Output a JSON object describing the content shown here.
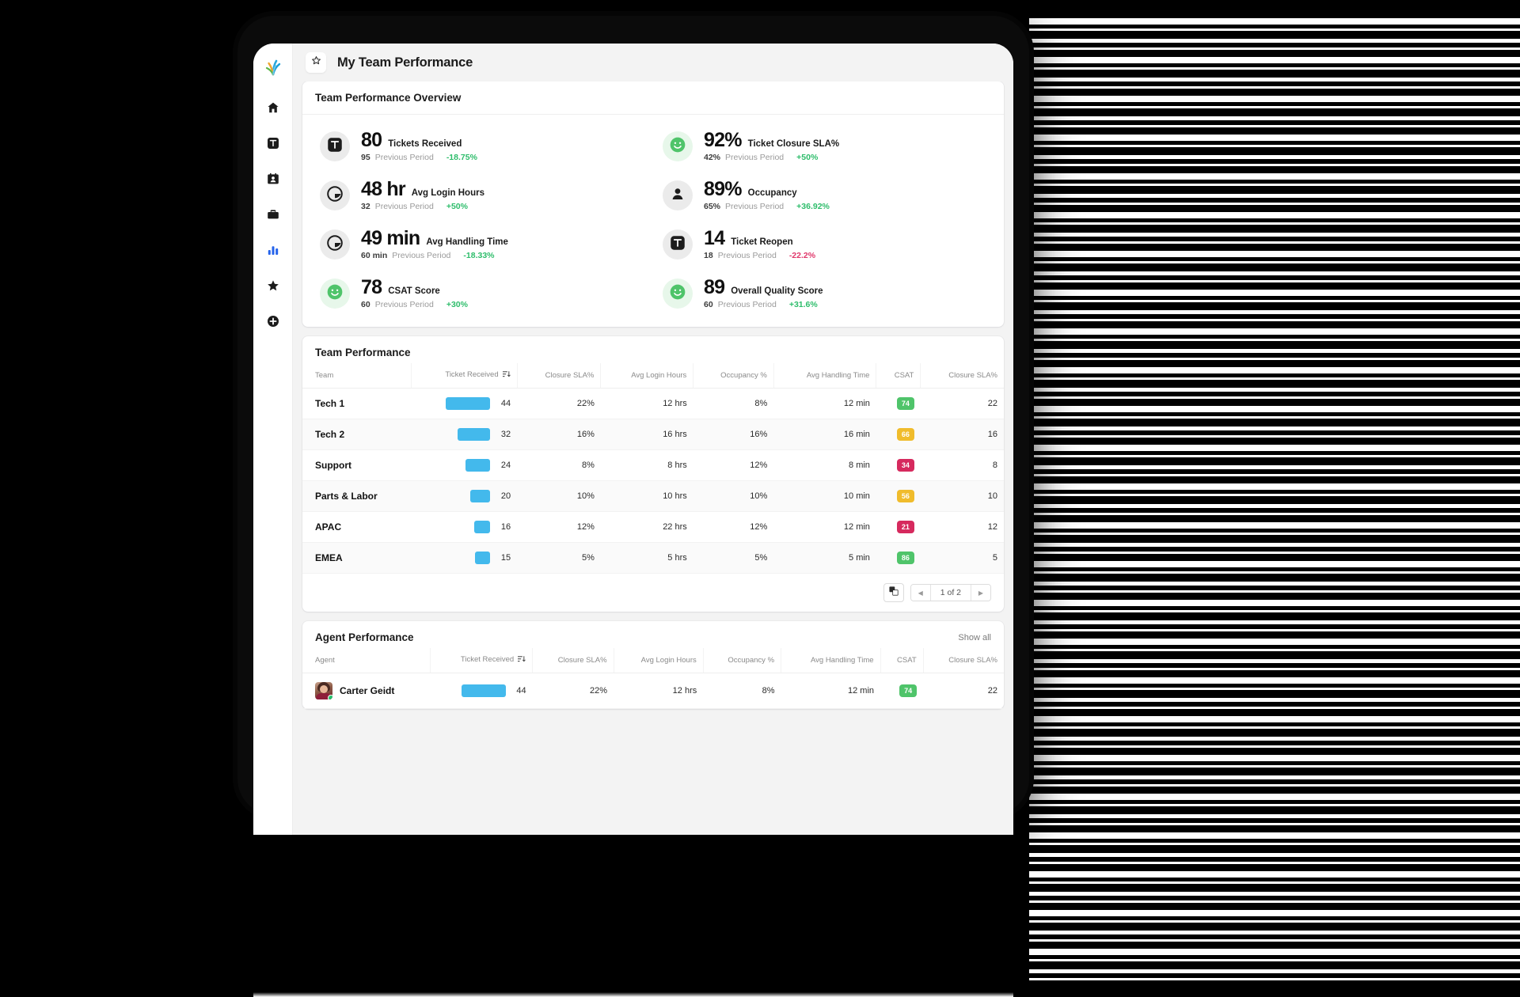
{
  "app": {
    "logo_name": "freshworks-logo",
    "page_title": "My Team Performance",
    "star_icon": "star-outline-icon"
  },
  "sidebar": {
    "items": [
      {
        "name": "home",
        "icon": "home-icon",
        "active": false
      },
      {
        "name": "tickets",
        "icon": "ticket-t-icon",
        "active": false
      },
      {
        "name": "contacts",
        "icon": "contact-card-icon",
        "active": false
      },
      {
        "name": "deals",
        "icon": "briefcase-icon",
        "active": false
      },
      {
        "name": "analytics",
        "icon": "bar-chart-icon",
        "active": true
      },
      {
        "name": "favorites",
        "icon": "star-icon",
        "active": false
      },
      {
        "name": "add",
        "icon": "plus-circle-icon",
        "active": false
      }
    ]
  },
  "overview": {
    "title": "Team Performance Overview",
    "previous_period_label": "Previous Period",
    "kpis": [
      {
        "icon": "ticket-t-icon",
        "icon_style": "dark",
        "value": "80",
        "label": "Tickets Received",
        "prev": "95",
        "delta": "-18.75%",
        "delta_dir": "up"
      },
      {
        "icon": "smiley-icon",
        "icon_style": "green",
        "value": "92%",
        "label": "Ticket Closure SLA%",
        "prev": "42%",
        "delta": "+50%",
        "delta_dir": "up"
      },
      {
        "icon": "clock-icon",
        "icon_style": "dark",
        "value": "48 hr",
        "label": "Avg Login Hours",
        "prev": "32",
        "delta": "+50%",
        "delta_dir": "up"
      },
      {
        "icon": "person-icon",
        "icon_style": "dark",
        "value": "89%",
        "label": "Occupancy",
        "prev": "65%",
        "delta": "+36.92%",
        "delta_dir": "up"
      },
      {
        "icon": "clock-icon",
        "icon_style": "dark",
        "value": "49 min",
        "label": "Avg Handling Time",
        "prev": "60 min",
        "delta": "-18.33%",
        "delta_dir": "up"
      },
      {
        "icon": "ticket-t-icon",
        "icon_style": "dark",
        "value": "14",
        "label": "Ticket Reopen",
        "prev": "18",
        "delta": "-22.2%",
        "delta_dir": "down"
      },
      {
        "icon": "smiley-icon",
        "icon_style": "green",
        "value": "78",
        "label": "CSAT Score",
        "prev": "60",
        "delta": "+30%",
        "delta_dir": "up"
      },
      {
        "icon": "smiley-icon",
        "icon_style": "green",
        "value": "89",
        "label": "Overall Quality Score",
        "prev": "60",
        "delta": "+31.6%",
        "delta_dir": "up"
      }
    ]
  },
  "team_table": {
    "title": "Team Performance",
    "columns": [
      "Team",
      "Ticket Received",
      "Closure SLA%",
      "Avg Login Hours",
      "Occupancy %",
      "Avg Handling Time",
      "CSAT",
      "Closure SLA%"
    ],
    "sort_column": "Ticket Received",
    "sort_icon": "sort-descending-icon",
    "rows": [
      {
        "name": "Tech 1",
        "tickets": 44,
        "bar_pct": 100,
        "closure_sla": "22%",
        "login_hours": "12 hrs",
        "occupancy": "8%",
        "handling_time": "12 min",
        "csat": "74",
        "csat_color": "#4fc46a",
        "closure_sla2": "22"
      },
      {
        "name": "Tech 2",
        "tickets": 32,
        "bar_pct": 73,
        "closure_sla": "16%",
        "login_hours": "16 hrs",
        "occupancy": "16%",
        "handling_time": "16 min",
        "csat": "66",
        "csat_color": "#f0bc2c",
        "closure_sla2": "16"
      },
      {
        "name": "Support",
        "tickets": 24,
        "bar_pct": 55,
        "closure_sla": "8%",
        "login_hours": "8 hrs",
        "occupancy": "12%",
        "handling_time": "8 min",
        "csat": "34",
        "csat_color": "#d62a5e",
        "closure_sla2": "8"
      },
      {
        "name": "Parts & Labor",
        "tickets": 20,
        "bar_pct": 45,
        "closure_sla": "10%",
        "login_hours": "10 hrs",
        "occupancy": "10%",
        "handling_time": "10 min",
        "csat": "56",
        "csat_color": "#f0bc2c",
        "closure_sla2": "10"
      },
      {
        "name": "APAC",
        "tickets": 16,
        "bar_pct": 36,
        "closure_sla": "12%",
        "login_hours": "22 hrs",
        "occupancy": "12%",
        "handling_time": "12 min",
        "csat": "21",
        "csat_color": "#d62a5e",
        "closure_sla2": "12"
      },
      {
        "name": "EMEA",
        "tickets": 15,
        "bar_pct": 34,
        "closure_sla": "5%",
        "login_hours": "5 hrs",
        "occupancy": "5%",
        "handling_time": "5 min",
        "csat": "86",
        "csat_color": "#4fc46a",
        "closure_sla2": "5"
      }
    ],
    "pager": {
      "copy_icon": "duplicate-icon",
      "prev_icon": "chevron-left-icon",
      "next_icon": "chevron-right-icon",
      "label": "1 of 2"
    }
  },
  "agent_table": {
    "title": "Agent Performance",
    "show_all": "Show all",
    "columns": [
      "Agent",
      "Ticket Received",
      "Closure SLA%",
      "Avg Login Hours",
      "Occupancy %",
      "Avg Handling Time",
      "CSAT",
      "Closure SLA%"
    ],
    "sort_column": "Ticket Received",
    "sort_icon": "sort-descending-icon",
    "rows": [
      {
        "name": "Carter Geidt",
        "avatar": "avatar-carter-geidt",
        "status": "online",
        "tickets": 44,
        "bar_pct": 100,
        "closure_sla": "22%",
        "login_hours": "12 hrs",
        "occupancy": "8%",
        "handling_time": "12 min",
        "csat": "74",
        "csat_color": "#4fc46a",
        "closure_sla2": "22"
      }
    ]
  },
  "colors": {
    "bar": "#43b9ec",
    "accent_blue": "#2563eb",
    "positive": "#2ebd6b",
    "negative": "#e0386b",
    "green_badge": "#4fc46a",
    "amber_badge": "#f0bc2c",
    "crimson_badge": "#d62a5e"
  }
}
